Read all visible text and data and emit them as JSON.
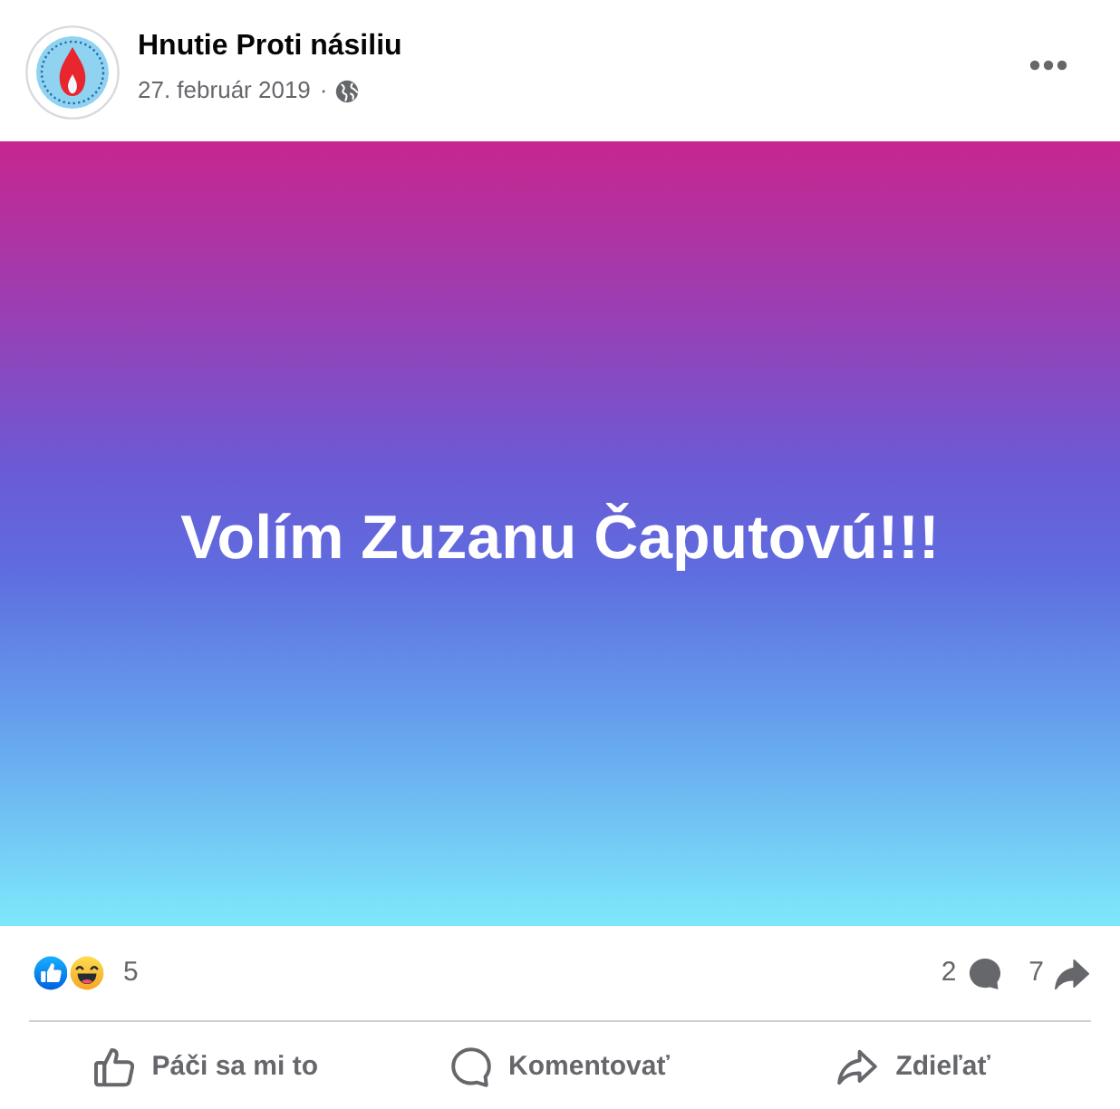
{
  "header": {
    "author": "Hnutie Proti násiliu",
    "date": "27. február 2019",
    "separator": "·"
  },
  "post": {
    "text": "Volím Zuzanu Čaputovú!!!"
  },
  "stats": {
    "reactions": [
      {
        "kind": "like"
      },
      {
        "kind": "haha"
      }
    ],
    "reaction_count": "5",
    "comment_count": "2",
    "share_count": "7"
  },
  "actions": [
    {
      "kind": "like",
      "label": "Páči sa mi to"
    },
    {
      "kind": "comment",
      "label": "Komentovať"
    },
    {
      "kind": "share",
      "label": "Zdieľať"
    }
  ]
}
